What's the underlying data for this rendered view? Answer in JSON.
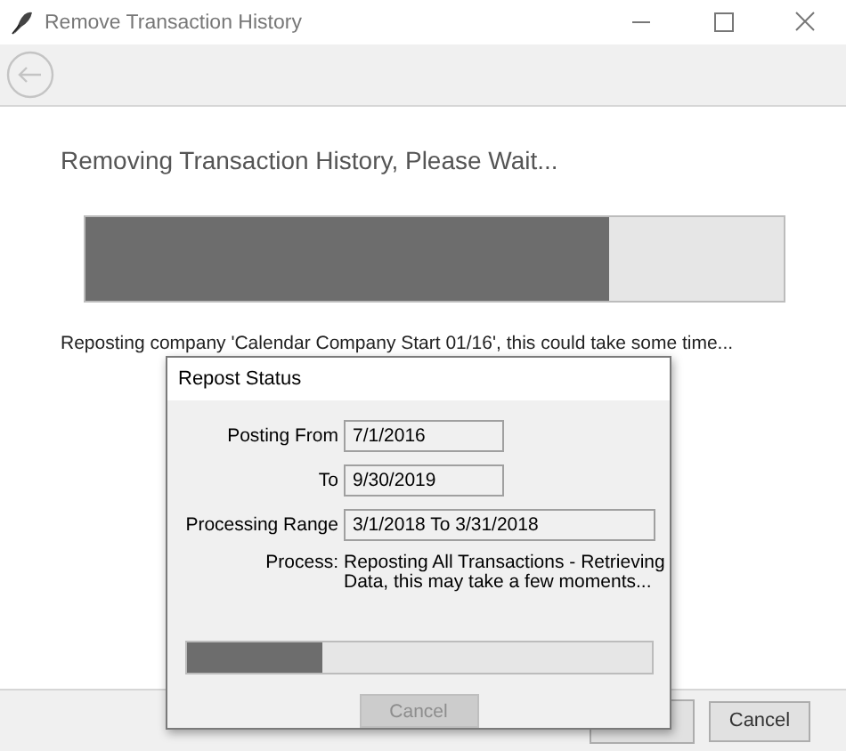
{
  "window": {
    "title": "Remove Transaction History"
  },
  "heading": "Removing Transaction History, Please Wait...",
  "progress": {
    "level": 0.75
  },
  "status_message": "Reposting company 'Calendar Company Start 01/16', this could take some time...",
  "footer": {
    "buttons": [
      {
        "label": "Cancel"
      }
    ]
  },
  "dialog": {
    "title": "Repost Status",
    "fields": [
      {
        "label": "Posting From",
        "value": "7/1/2016",
        "kind": "short"
      },
      {
        "label": "To",
        "value": "9/30/2019",
        "kind": "short"
      },
      {
        "label": "Processing Range",
        "value": "3/1/2018 To 3/31/2018",
        "kind": "long"
      }
    ],
    "process_label": "Process:",
    "process_text": "Reposting All Transactions - Retrieving Data, this may take a few moments...",
    "progress": {
      "level": 0.29
    },
    "cancel": {
      "label": "Cancel",
      "disabled": true
    }
  }
}
